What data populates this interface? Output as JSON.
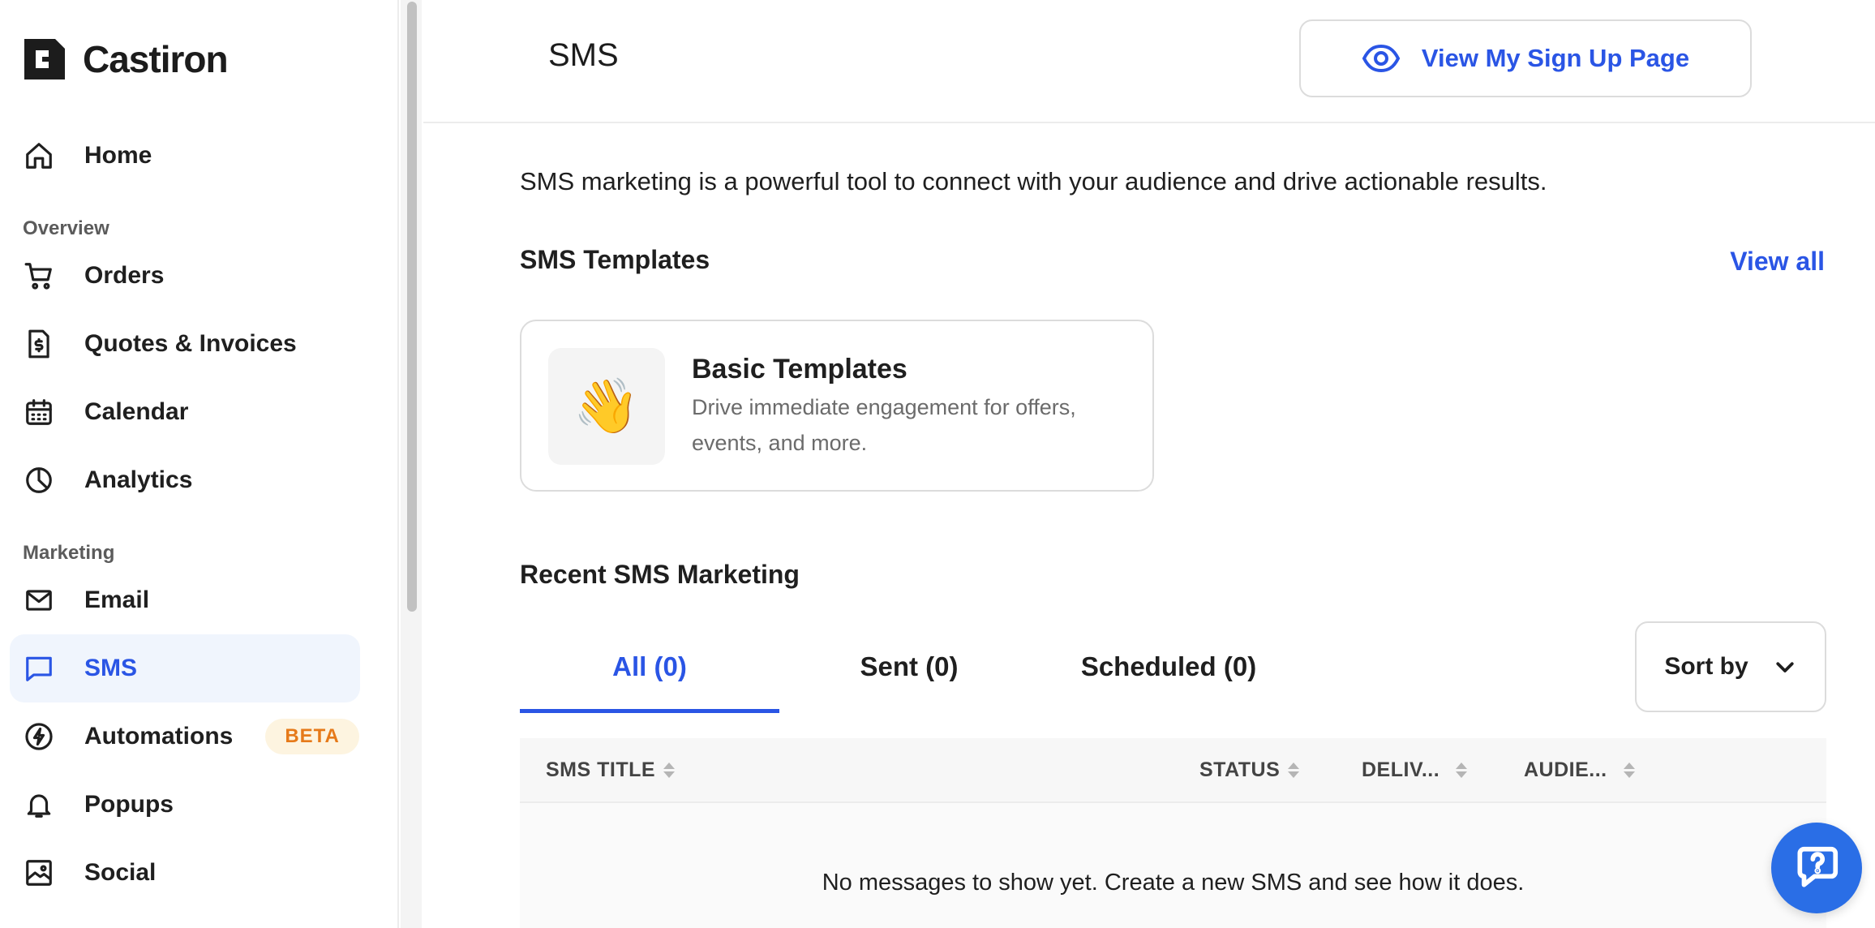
{
  "brand": {
    "name": "Castiron",
    "accent": "#2a55e5"
  },
  "sidebar": {
    "home": "Home",
    "overview_label": "Overview",
    "overview_items": [
      "Orders",
      "Quotes & Invoices",
      "Calendar",
      "Analytics"
    ],
    "marketing_label": "Marketing",
    "marketing_items": {
      "email": "Email",
      "sms": "SMS",
      "automations": "Automations",
      "automations_badge": "BETA",
      "popups": "Popups",
      "social": "Social"
    }
  },
  "header": {
    "title": "SMS",
    "signup_button": "View My Sign Up Page"
  },
  "main": {
    "intro": "SMS marketing is a powerful tool to connect with your audience and drive actionable results.",
    "templates_title": "SMS Templates",
    "view_all": "View all",
    "template_card": {
      "emoji": "👋",
      "name": "Basic Templates",
      "description": "Drive immediate engagement for offers, events, and more."
    },
    "recent_title": "Recent SMS Marketing",
    "tabs": [
      "All (0)",
      "Sent (0)",
      "Scheduled (0)"
    ],
    "sort_label": "Sort by",
    "table": {
      "columns": [
        "SMS TITLE",
        "STATUS",
        "DELIV...",
        "AUDIE..."
      ],
      "empty_message": "No messages to show yet. Create a new SMS and see how it does."
    }
  }
}
